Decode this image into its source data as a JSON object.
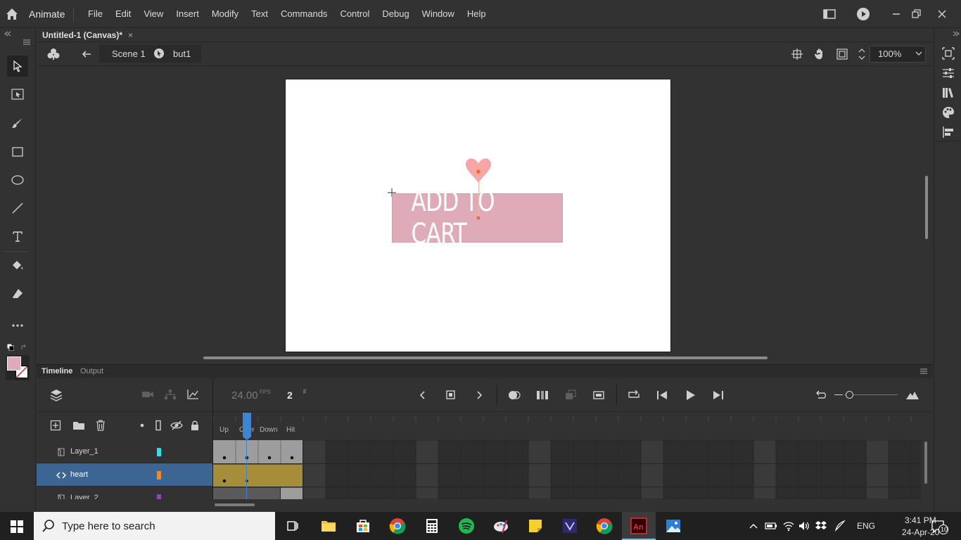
{
  "app": {
    "name": "Animate"
  },
  "menu": {
    "items": [
      "File",
      "Edit",
      "View",
      "Insert",
      "Modify",
      "Text",
      "Commands",
      "Control",
      "Debug",
      "Window",
      "Help"
    ]
  },
  "document": {
    "tab_title": "Untitled-1 (Canvas)*",
    "close_glyph": "×"
  },
  "editbar": {
    "scene": "Scene 1",
    "symbol": "but1",
    "zoom": "100%"
  },
  "stage": {
    "button_text": "ADD TO CART",
    "background": "#ffffff",
    "button_color": "#dfabb9",
    "heart_color": "#f7a6a6"
  },
  "timeline": {
    "tabs": {
      "timeline": "Timeline",
      "output": "Output"
    },
    "fps": "24.00",
    "fps_unit": "FPS",
    "current_frame": "2",
    "frame_unit": "F",
    "frame_labels": [
      "Up",
      "Over",
      "Down",
      "Hit"
    ],
    "layers": [
      {
        "name": "Layer_1",
        "color": "#27e1f0",
        "selected": false
      },
      {
        "name": "heart",
        "color": "#f08a1e",
        "selected": true
      },
      {
        "name": "Layer_2",
        "color": "#9a3bd1",
        "selected": false
      }
    ]
  },
  "taskbar": {
    "search_placeholder": "Type here to search",
    "language": "ENG",
    "time": "3:41 PM",
    "date": "24-Apr-20",
    "notification_count": "10"
  }
}
